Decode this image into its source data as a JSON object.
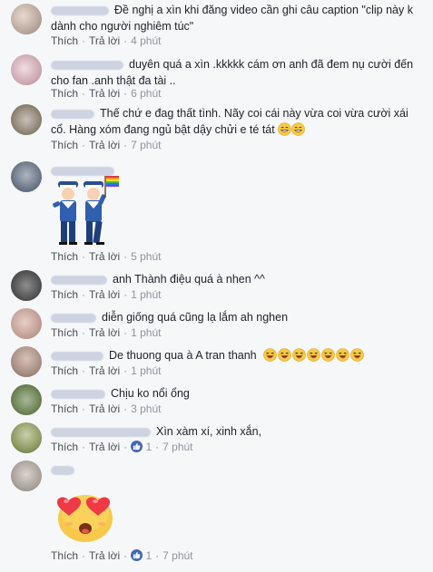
{
  "action_labels": {
    "like": "Thích",
    "reply": "Trả lời"
  },
  "comments": [
    {
      "text": "Đề nghị a xìn khi đăng video cần ghi câu caption \"clip này k dành cho người nghiêm túc\"",
      "time": "4 phút"
    },
    {
      "text": "duyên quá a xìn .kkkkk cám ơn anh đã đem nụ cười đến cho fan .anh thật đa tài ..",
      "time": "6 phút"
    },
    {
      "text": "Thế chứ e đag thất tình. Nãy coi cái này vừa coi vừa cười xái cổ. Hàng xóm đang ngủ bật dậy chửi e té tát",
      "time": "7 phút",
      "emoji": "grin-icon"
    },
    {
      "text": "",
      "time": "5 phút",
      "sticker": "sailor-couple-rainbow-flag-sticker"
    },
    {
      "text": "anh Thành điệu quá à nhen ^^",
      "time": "1 phút"
    },
    {
      "text": "diễn giống quá cũng lạ lắm ah nghen",
      "time": "1 phút"
    },
    {
      "text": "De thuong qua à A tran thanh",
      "time": "1 phút",
      "emoji": "laughing-icon"
    },
    {
      "text": "Chịu ko nổi ổng",
      "time": "3 phút"
    },
    {
      "text": "Xìn xàm xí, xinh xắn,",
      "time": "7 phút",
      "likes": "1"
    },
    {
      "text": "",
      "time": "7 phút",
      "likes": "1",
      "sticker": "heart-eyes-sticker"
    }
  ],
  "colors": {
    "link": "#4b4f56",
    "meta": "#90949c",
    "like_badge": "#4267b2",
    "background": "#f6f7f9"
  }
}
